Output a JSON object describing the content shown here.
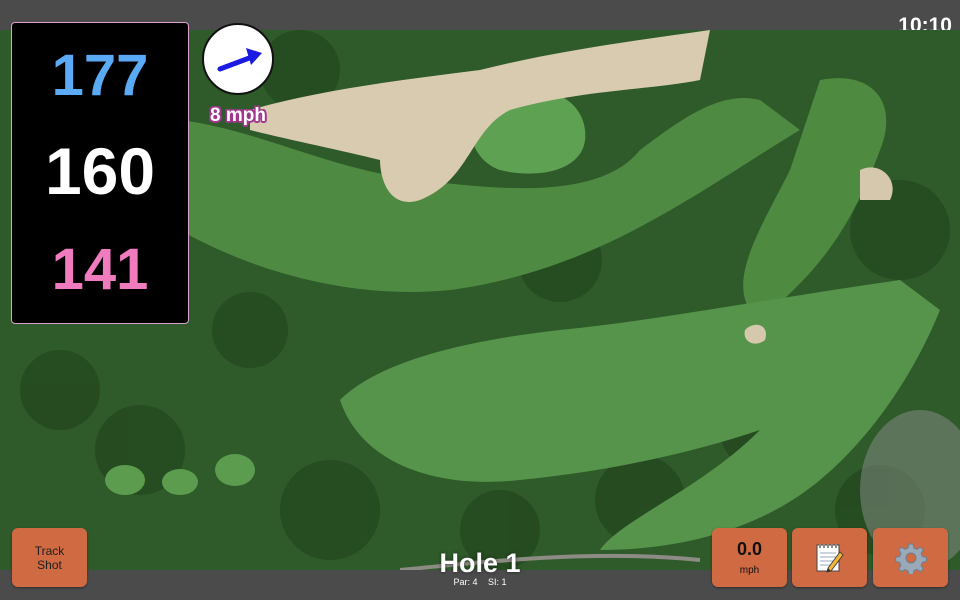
{
  "status": {
    "time": "10:10"
  },
  "distances": {
    "back": "177",
    "middle": "160",
    "front": "141",
    "colors": {
      "back": "#5aaaf6",
      "middle": "#ffffff",
      "front": "#f07bbf"
    }
  },
  "wind": {
    "speed_label": "8 mph",
    "arrow_color": "#1a1ae0",
    "icon": "wind-direction-arrow-icon"
  },
  "buttons": {
    "track_shot": "Track\nShot",
    "speed_value": "0.0",
    "speed_unit": "mph",
    "notes_icon": "notepad-icon",
    "settings_icon": "gear-icon"
  },
  "hole": {
    "title": "Hole 1",
    "par": "Par: 4",
    "si": "SI: 1"
  },
  "theme": {
    "button_color": "#cf6a43",
    "bar_color": "#4b4b4b"
  }
}
